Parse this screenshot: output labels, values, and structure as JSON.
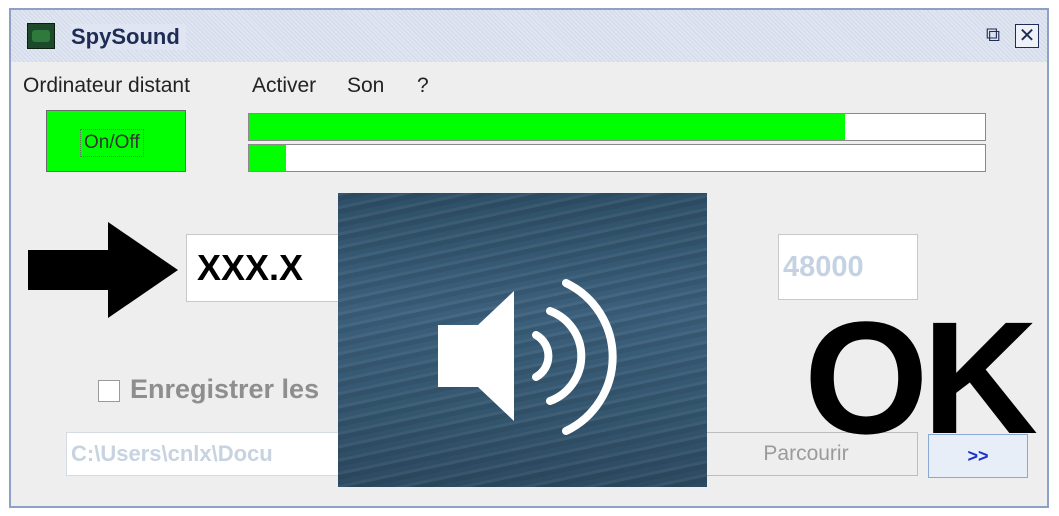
{
  "window": {
    "title": "SpySound",
    "restore_glyph": "⧉",
    "close_glyph": "✕"
  },
  "menu": {
    "items": [
      {
        "label": "Ordinateur distant"
      },
      {
        "label": "Activer"
      },
      {
        "label": "Son"
      },
      {
        "label": "?"
      }
    ]
  },
  "controls": {
    "onoff_label": "On/Off",
    "level_top": 0.81,
    "level_bottom": 0.05,
    "ip_value": "XXX.X",
    "rate_value": "48000",
    "record_label": "Enregistrer les",
    "path_value": "C:\\Users\\cnlx\\Docu",
    "browse_label": "Parcourir",
    "next_label": ">>"
  },
  "overlay": {
    "icon": "speaker-volume-icon",
    "ok_text": "OK"
  },
  "colors": {
    "level_green": "#00ff00",
    "title_text": "#1f2d55",
    "next_text": "#1a30c8"
  }
}
